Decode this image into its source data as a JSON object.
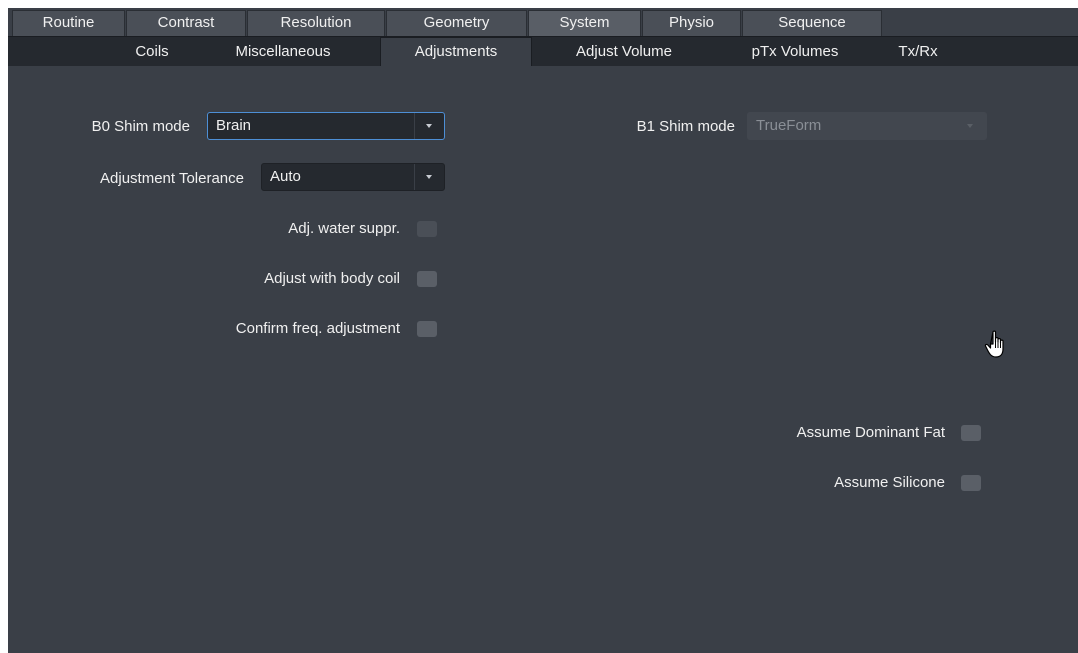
{
  "tabs_top": [
    {
      "label": "Routine"
    },
    {
      "label": "Contrast"
    },
    {
      "label": "Resolution"
    },
    {
      "label": "Geometry"
    },
    {
      "label": "System"
    },
    {
      "label": "Physio"
    },
    {
      "label": "Sequence"
    }
  ],
  "tabs_sub": [
    {
      "label": "Coils"
    },
    {
      "label": "Miscellaneous"
    },
    {
      "label": "Adjustments"
    },
    {
      "label": "Adjust Volume"
    },
    {
      "label": "pTx Volumes"
    },
    {
      "label": "Tx/Rx"
    }
  ],
  "form": {
    "b0_shim": {
      "label": "B0 Shim mode",
      "value": "Brain"
    },
    "b1_shim": {
      "label": "B1 Shim mode",
      "value": "TrueForm"
    },
    "adj_tolerance": {
      "label": "Adjustment Tolerance",
      "value": "Auto"
    },
    "adj_water_suppr": {
      "label": "Adj. water suppr.",
      "checked": false,
      "enabled": false
    },
    "adjust_body_coil": {
      "label": "Adjust with body coil",
      "checked": false
    },
    "confirm_freq": {
      "label": "Confirm freq. adjustment",
      "checked": false
    },
    "assume_dominant_fat": {
      "label": "Assume Dominant Fat",
      "checked": false
    },
    "assume_silicone": {
      "label": "Assume Silicone",
      "checked": false
    }
  },
  "colors": {
    "panel_bg": "#3a3f47",
    "subtab_bg": "#25292f",
    "focus_border": "#4d8fd6",
    "text": "#f0f0f0"
  },
  "icons": {
    "cursor": "hand-pointer-icon",
    "dropdown": "chevron-down-icon"
  }
}
